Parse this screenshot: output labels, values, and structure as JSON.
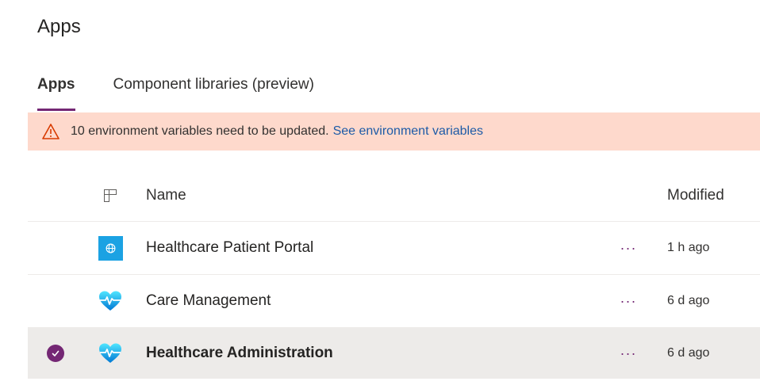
{
  "page": {
    "title": "Apps"
  },
  "tabs": [
    {
      "label": "Apps",
      "active": true
    },
    {
      "label": "Component libraries (preview)",
      "active": false
    }
  ],
  "banner": {
    "icon": "warning-icon",
    "message": "10 environment variables need to be updated.",
    "link": "See environment variables",
    "background": "#fed9cc"
  },
  "table": {
    "columns": {
      "name": "Name",
      "modified": "Modified"
    },
    "column_icon": "file-type-icon",
    "rows": [
      {
        "name": "Healthcare Patient Portal",
        "modified": "1 h ago",
        "icon": "globe-portal-icon",
        "more": "···",
        "selected": false
      },
      {
        "name": "Care Management",
        "modified": "6 d ago",
        "icon": "heart-pulse-icon",
        "more": "···",
        "selected": false
      },
      {
        "name": "Healthcare Administration",
        "modified": "6 d ago",
        "icon": "heart-pulse-icon",
        "more": "···",
        "selected": true
      }
    ]
  },
  "colors": {
    "accent": "#742774",
    "link": "#1d5ba7",
    "selected_row": "#edebe9"
  }
}
